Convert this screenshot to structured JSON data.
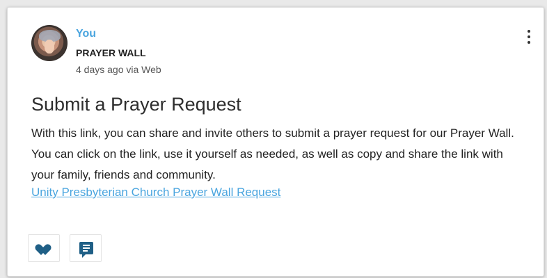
{
  "post": {
    "author": "You",
    "group": "PRAYER WALL",
    "meta": "4 days ago via Web",
    "title": "Submit a Prayer Request",
    "body": "With this link, you can share and invite others to submit a prayer request for our Prayer Wall.  You can click on the link, use it yourself as needed, as well as copy and share the link with your family, friends and community.",
    "link_text": "Unity Presbyterian Church Prayer Wall Request"
  },
  "icons": {
    "avatar": "user-avatar",
    "menu": "more-vertical-icon",
    "like": "heart-icon",
    "comment": "comment-icon"
  },
  "colors": {
    "accent": "#4aa5df",
    "icon": "#1f5f86",
    "text": "#222222"
  }
}
